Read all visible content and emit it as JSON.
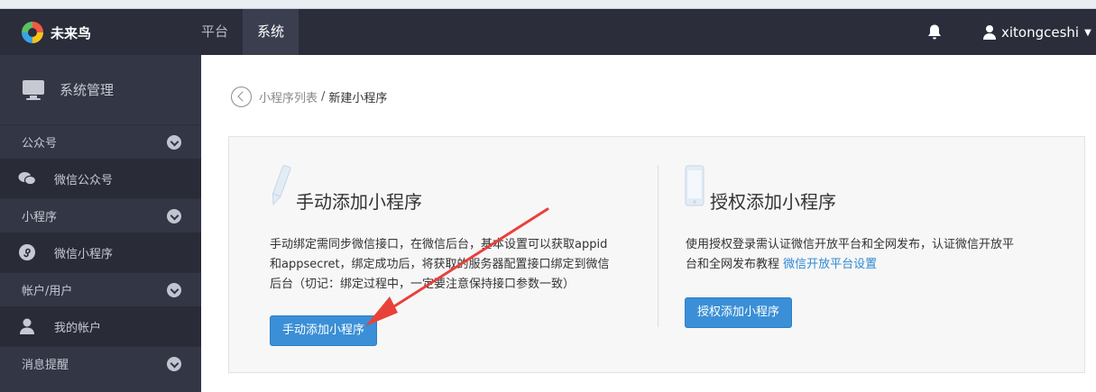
{
  "topbar": {
    "logo_text": "未来鸟",
    "nav": [
      {
        "label": "平台",
        "active": false
      },
      {
        "label": "系统",
        "active": true
      }
    ],
    "username": "xitongceshi",
    "bell_icon": "bell-icon",
    "user_icon": "user-icon"
  },
  "sidebar": {
    "header": "系统管理",
    "groups": [
      {
        "label": "公众号",
        "item": {
          "label": "微信公众号",
          "icon": "wechat-icon"
        }
      },
      {
        "label": "小程序",
        "item": {
          "label": "微信小程序",
          "icon": "miniprogram-icon"
        }
      },
      {
        "label": "帐户/用户",
        "item": {
          "label": "我的帐户",
          "icon": "user-icon"
        }
      },
      {
        "label": "消息提醒"
      }
    ]
  },
  "breadcrumb": {
    "link": "小程序列表",
    "separator": "/",
    "current": "新建小程序"
  },
  "manual": {
    "title": "手动添加小程序",
    "description": [
      "手动绑定需同步微信接口，在微信后台，基本设置可以获取appid",
      "和appsecret，绑定成功后，将获取的服务器配置接口绑定到微信",
      "后台（切记：绑定过程中，一定要注意保持接口参数一致）"
    ],
    "button": "手动添加小程序"
  },
  "auth": {
    "title": "授权添加小程序",
    "description_line1": "使用授权登录需认证微信开放平台和全网发布，认证微信开放平",
    "description_line2": "台和全网发布教程",
    "link": "微信开放平台设置",
    "button": "授权添加小程序"
  },
  "colors": {
    "topbar": "#2b2d3b",
    "sidebar": "#333645",
    "button": "#3b8fd6",
    "link": "#2f8ad4",
    "annotation_arrow": "#e8413a"
  }
}
